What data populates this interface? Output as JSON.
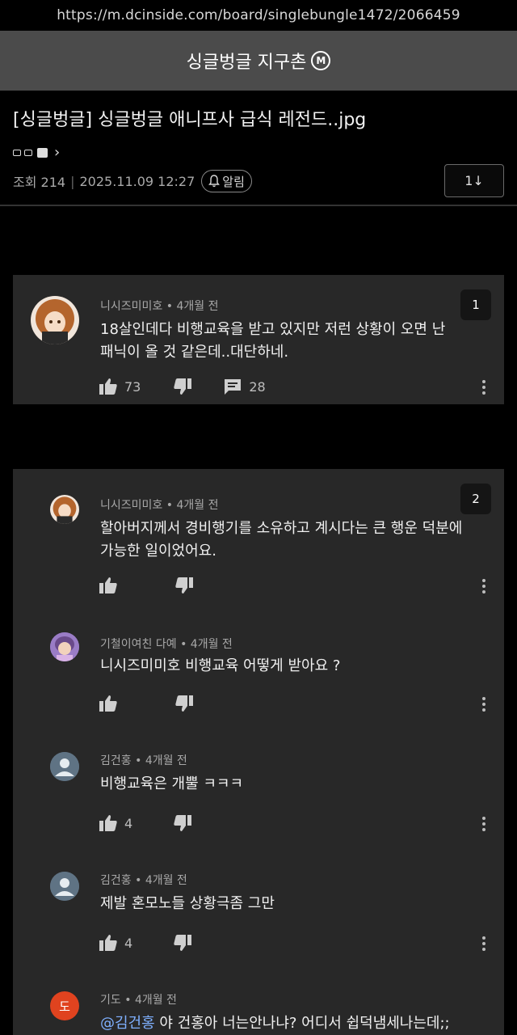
{
  "browser": {
    "url": "https://m.dcinside.com/board/singlebungle1472/2066459"
  },
  "gallery": {
    "name": "싱글벙글 지구촌",
    "badge": "M"
  },
  "post": {
    "title": "[싱글벙글] 싱글벙글 애니프사 급식 레전드..jpg",
    "views": "조회 214",
    "date": "2025.11.09 12:27",
    "alarm_label": "알림",
    "page_button": "1↓"
  },
  "colors": {
    "background": "#000000",
    "card": "#282828",
    "header": "#4b4b4b",
    "mention": "#7fb0ff",
    "avatar_letter": "#e0431f"
  },
  "card1": {
    "index": "1",
    "comment": {
      "author": "니시즈미미호",
      "time": "4개월 전",
      "text_line1": "18살인데다 비행교육을 받고 있지만 저런 상황이 오면 난",
      "text_line2": "패닉이 올 것 같은데..대단하네.",
      "likes": "73",
      "replies": "28"
    }
  },
  "card2": {
    "index": "2",
    "comments": [
      {
        "author": "니시즈미미호",
        "time": "4개월 전",
        "text_line1": "할아버지께서 경비행기를 소유하고 계시다는 큰 행운 덕분에",
        "text_line2": "가능한 일이었어요.",
        "likes": ""
      },
      {
        "author": "기철이여친 다예",
        "time": "4개월 전",
        "text_line1": "니시즈미미호 비행교육 어떻게 받아요 ?",
        "likes": ""
      },
      {
        "author": "김건홍",
        "time": "4개월 전",
        "text_line1": "비행교육은 개뿔 ㅋㅋㅋ",
        "likes": "4"
      },
      {
        "author": "김건홍",
        "time": "4개월 전",
        "text_line1": "제발 혼모노들 상황극좀 그만",
        "likes": "4"
      },
      {
        "author": "기도",
        "time": "4개월 전",
        "avatar_letter": "도",
        "mention": "@김건홍",
        "text_line1": " 야 건홍아 너는안나냐? 어디서 쉽덕냄세나는데;;"
      }
    ]
  },
  "separator": "•"
}
